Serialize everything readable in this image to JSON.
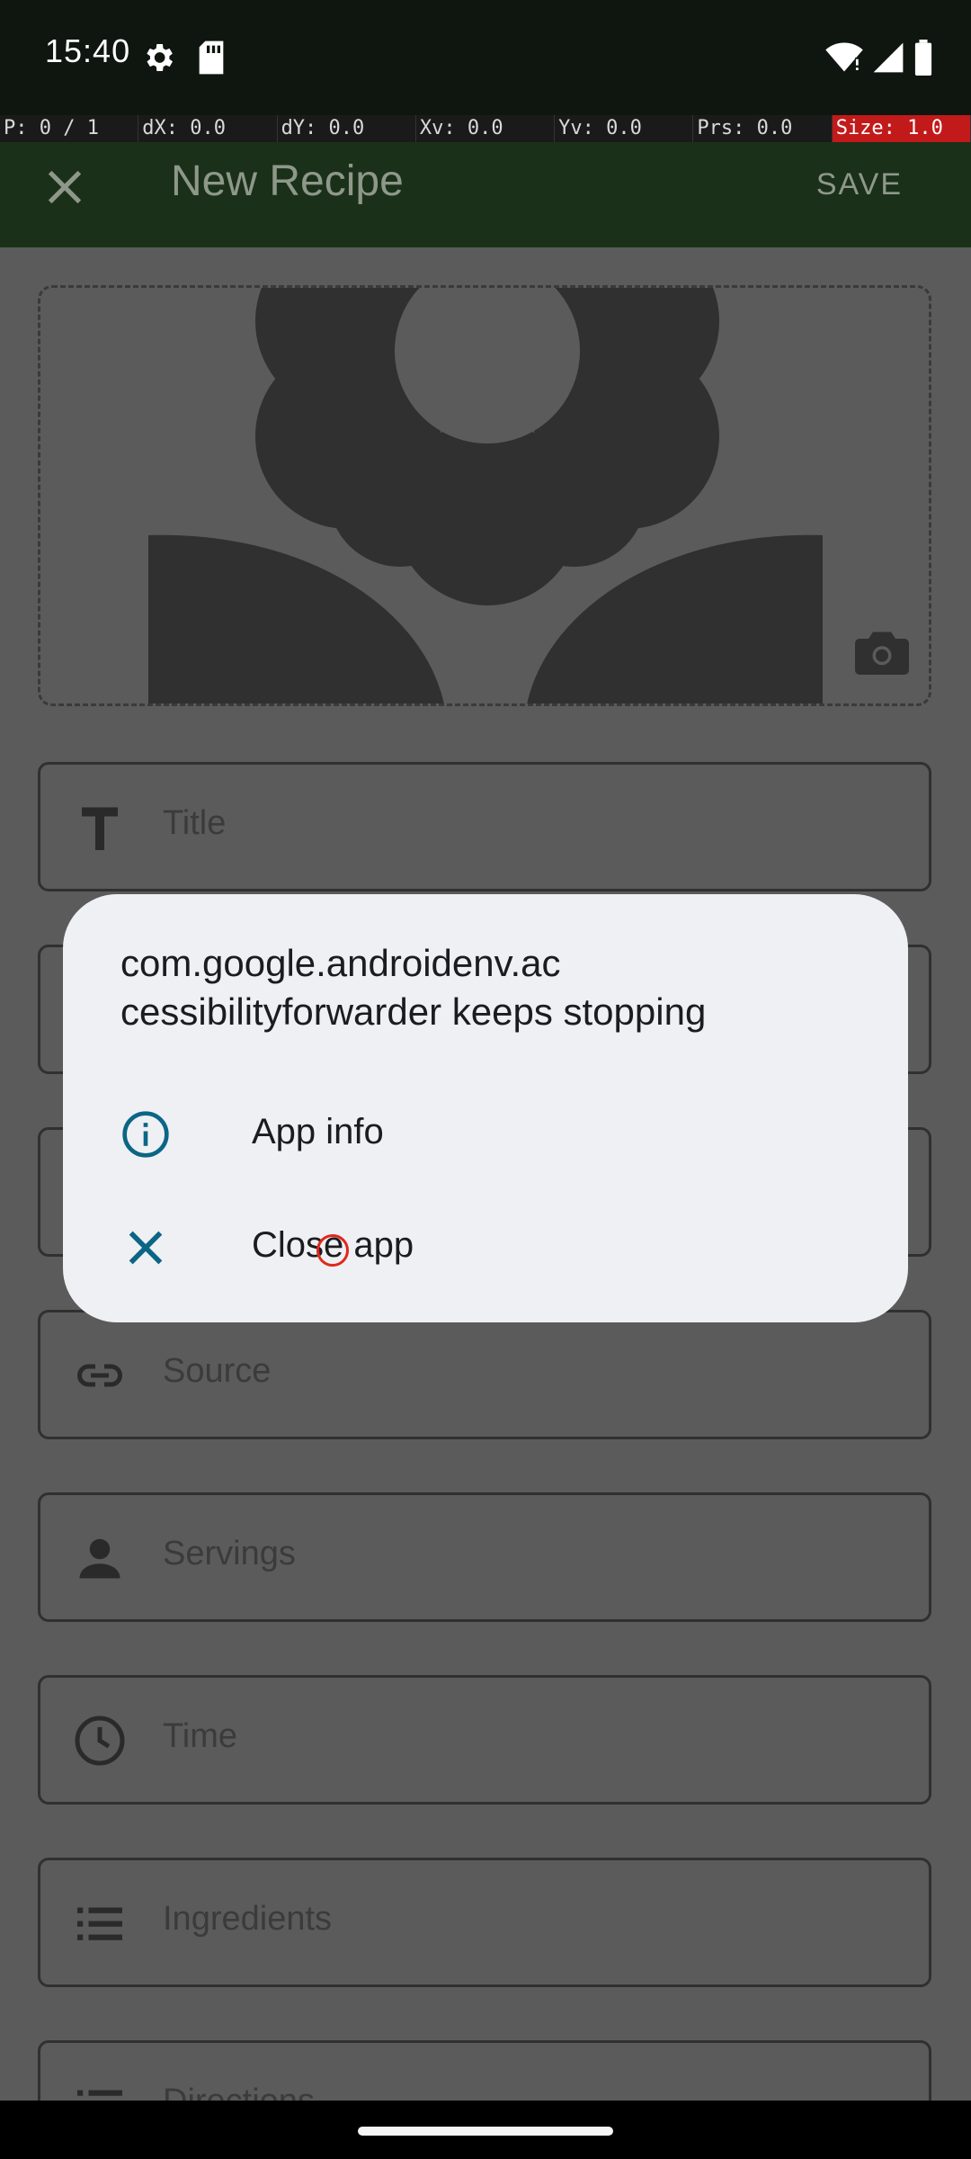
{
  "status_bar": {
    "time": "15:40",
    "left_icons": [
      "settings-icon",
      "sd-card-icon"
    ],
    "right_icons": [
      "wifi-icon",
      "signal-icon",
      "battery-icon"
    ]
  },
  "pointer_overlay": {
    "cells": [
      "P: 0 / 1",
      "dX: 0.0",
      "dY: 0.0",
      "Xv: 0.0",
      "Yv: 0.0",
      "Prs: 0.0",
      "Size: 1.0"
    ],
    "highlight_color": "#c21a1a"
  },
  "app_bar": {
    "title": "New Recipe",
    "save_label": "SAVE",
    "background": "#1b3018"
  },
  "form": {
    "image_placeholder_icon": "flower-icon",
    "camera_icon": "camera-icon",
    "fields": [
      {
        "label": "Title",
        "icon": "title-icon"
      },
      {
        "label": "",
        "icon": ""
      },
      {
        "label": "",
        "icon": ""
      },
      {
        "label": "Source",
        "icon": "link-icon"
      },
      {
        "label": "Servings",
        "icon": "person-icon"
      },
      {
        "label": "Time",
        "icon": "clock-icon"
      },
      {
        "label": "Ingredients",
        "icon": "list-icon"
      },
      {
        "label": "Directions",
        "icon": "list-numbered-icon"
      }
    ]
  },
  "dialog": {
    "title": "com.google.androidenv.accessibilityforwarder keeps stopping",
    "title_line1": "com.google.androidenv.ac",
    "title_line2": "cessibilityforwarder keeps stopping",
    "items": [
      {
        "label": "App info",
        "icon": "info-icon"
      },
      {
        "label": "Close app",
        "icon": "close-icon"
      }
    ],
    "accent_color": "#0b6585"
  }
}
